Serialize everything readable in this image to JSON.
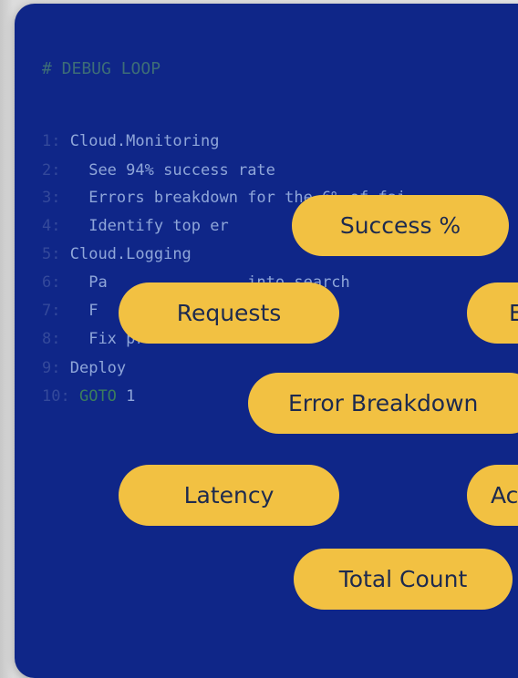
{
  "heading": "# DEBUG LOOP",
  "code_lines": [
    {
      "num": "1:",
      "text": "Cloud.Monitoring"
    },
    {
      "num": "2:",
      "text": "  See 94% success rate"
    },
    {
      "num": "3:",
      "text": "  Errors breakdown for the 6% of fai"
    },
    {
      "num": "4:",
      "text": "  Identify top er                d"
    },
    {
      "num": "5:",
      "text": "Cloud.Logging"
    },
    {
      "num": "6:",
      "text": "  Pa               into search"
    },
    {
      "num": "7:",
      "text": "  F"
    },
    {
      "num": "8:",
      "text": "  Fix problem"
    },
    {
      "num": "9:",
      "text": "Deploy"
    },
    {
      "num": "10:",
      "goto": "GOTO",
      "text": " 1"
    }
  ],
  "pills": {
    "success": "Success %",
    "requests": "Requests",
    "b_partial": "E",
    "error_breakdown": "Error Breakdown",
    "latency": "Latency",
    "a_partial": "Ac",
    "total_count": "Total Count"
  },
  "colors": {
    "panel": "#0f2688",
    "pill": "#f2c142",
    "pill_text": "#1d2a4f",
    "code_text": "#8fa6d9",
    "line_number": "#34499b",
    "heading": "#3d6d77",
    "goto": "#3b7d5c"
  }
}
